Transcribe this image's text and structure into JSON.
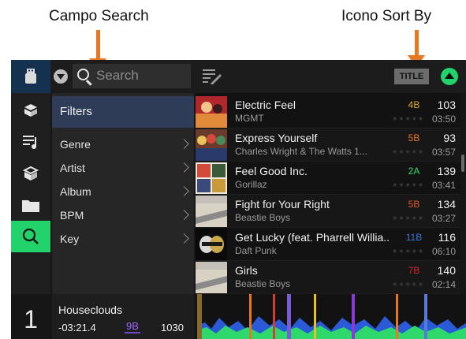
{
  "annotations": {
    "search_field_label": "Campo Search",
    "sort_by_icon_label": "Icono Sort By",
    "arrow_color": "#e87722"
  },
  "top_bar": {
    "search_placeholder": "Search",
    "sort_button_label": "TITLE",
    "icons": [
      "usb-icon",
      "dropdown-icon",
      "search-icon",
      "edit-list-icon",
      "scroll-up-icon"
    ]
  },
  "sidebar": {
    "icons": [
      "crate-icon",
      "playlist-icon",
      "prepare-icon",
      "folder-icon",
      "search-icon"
    ],
    "active": "search-icon",
    "accent": "#22d26a"
  },
  "filters": {
    "title": "Filters",
    "items": [
      {
        "label": "Genre"
      },
      {
        "label": "Artist"
      },
      {
        "label": "Album"
      },
      {
        "label": "BPM"
      },
      {
        "label": "Key"
      }
    ]
  },
  "tracks": [
    {
      "title": "Electric Feel",
      "artist": "MGMT",
      "key": "4B",
      "key_color": "#e0a81c",
      "bpm": "103",
      "length": "03:50",
      "stars": "★★★★★"
    },
    {
      "title": "Express Yourself",
      "artist": "Charles Wright & The Watts 1...",
      "key": "5B",
      "key_color": "#e87722",
      "bpm": "93",
      "length": "03:57",
      "stars": "★★★★★"
    },
    {
      "title": "Feel Good Inc.",
      "artist": "Gorillaz",
      "key": "2A",
      "key_color": "#2ee06a",
      "bpm": "139",
      "length": "03:41",
      "stars": "★★★★★"
    },
    {
      "title": "Fight for Your Right",
      "artist": "Beastie Boys",
      "key": "5B",
      "key_color": "#e05a2a",
      "bpm": "134",
      "length": "03:27",
      "stars": "★★★★★"
    },
    {
      "title": "Get Lucky (feat. Pharrell Willia...",
      "artist": "Daft Punk",
      "key": "11B",
      "key_color": "#3a78d8",
      "bpm": "116",
      "length": "06:10",
      "stars": "★★★★★"
    },
    {
      "title": "Girls",
      "artist": "Beastie Boys",
      "key": "7B",
      "key_color": "#d8242a",
      "bpm": "140",
      "length": "02:14",
      "stars": "★★★★★"
    }
  ],
  "deck": {
    "number": "1",
    "track": "Houseclouds",
    "time": "-03:21.4",
    "key": "9B",
    "bpm": "1030"
  }
}
